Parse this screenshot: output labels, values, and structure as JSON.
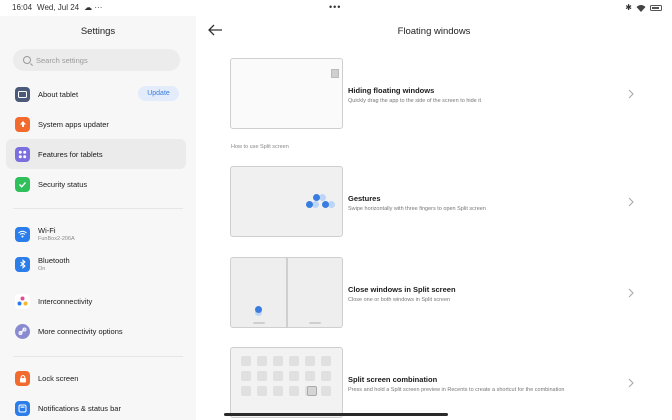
{
  "status": {
    "time": "16:04",
    "date": "Wed, Jul 24",
    "extra": "☁ ···",
    "center_dots": "•••"
  },
  "settings": {
    "title": "Settings",
    "search_placeholder": "Search settings",
    "items": [
      {
        "label": "About tablet",
        "button": "Update",
        "icon": "tablet-icon",
        "color": "#4a5a78"
      },
      {
        "label": "System apps updater",
        "icon": "arrow-up-icon",
        "color": "#f26a2e"
      },
      {
        "label": "Features for tablets",
        "icon": "grid-icon",
        "color": "#7b6fe0"
      },
      {
        "label": "Security status",
        "icon": "shield-check-icon",
        "color": "#2fbf5b"
      },
      {
        "label": "Wi-Fi",
        "sub": "FunBox2-206A",
        "icon": "wifi-icon",
        "color": "#2b7de9"
      },
      {
        "label": "Bluetooth",
        "sub": "On",
        "icon": "bluetooth-icon",
        "color": "#2b7de9"
      },
      {
        "label": "Interconnectivity",
        "icon": "interconnect-icon",
        "color": "#ffffff"
      },
      {
        "label": "More connectivity options",
        "icon": "link-icon",
        "color": "#8a8ad0"
      },
      {
        "label": "Lock screen",
        "icon": "lock-icon",
        "color": "#f26a2e"
      },
      {
        "label": "Notifications & status bar",
        "icon": "bell-icon",
        "color": "#2b7de9"
      }
    ]
  },
  "floating": {
    "title": "Floating windows",
    "section_label": "How to use Split screen",
    "rows": [
      {
        "title": "Hiding floating windows",
        "desc": "Quickly drag the app to the side of the screen to hide it"
      },
      {
        "title": "Gestures",
        "desc": "Swipe horizontally with three fingers to open Split screen"
      },
      {
        "title": "Close windows in Split screen",
        "desc": "Close one or both windows in Split screen"
      },
      {
        "title": "Split screen combination",
        "desc": "Press and hold a Split screen preview in Recents to create a shortcut for the combination"
      }
    ]
  },
  "colors": {
    "accent": "#3a7de0",
    "active_bg": "#ebebeb"
  }
}
